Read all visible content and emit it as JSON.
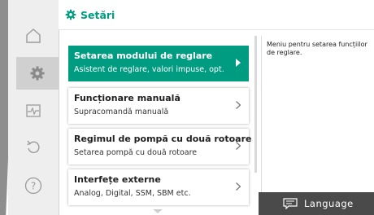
{
  "header": {
    "title": "Setări",
    "icon": "gear-icon",
    "accent": "#009c82"
  },
  "sidebar": {
    "items": [
      {
        "name": "home",
        "icon": "home-icon"
      },
      {
        "name": "settings",
        "icon": "gear-icon",
        "active": true
      },
      {
        "name": "diagnostics",
        "icon": "pulse-icon"
      },
      {
        "name": "restore",
        "icon": "undo-icon"
      },
      {
        "name": "help",
        "icon": "help-icon"
      }
    ]
  },
  "menu": {
    "items": [
      {
        "title": "Setarea modului de reglare",
        "subtitle": "Asistent de reglare, valori impuse, opt…",
        "selected": true
      },
      {
        "title": "Funcționare manuală",
        "subtitle": "Supracomandă manuală",
        "selected": false
      },
      {
        "title": "Regimul de pompă cu două rotoare",
        "subtitle": "Setarea pompă cu două rotoare",
        "selected": false
      },
      {
        "title": "Interfețe externe",
        "subtitle": "Analog, Digital, SSM, SBM etc.",
        "selected": false
      }
    ]
  },
  "info": {
    "text": "Meniu pentru setarea funcțiilor de reglare."
  },
  "footer": {
    "language_label": "Language",
    "language_icon": "chat-icon"
  },
  "colors": {
    "accent": "#009c82",
    "sidebar_bg": "#eeeeee",
    "footer_bg": "#4a4a4a"
  }
}
